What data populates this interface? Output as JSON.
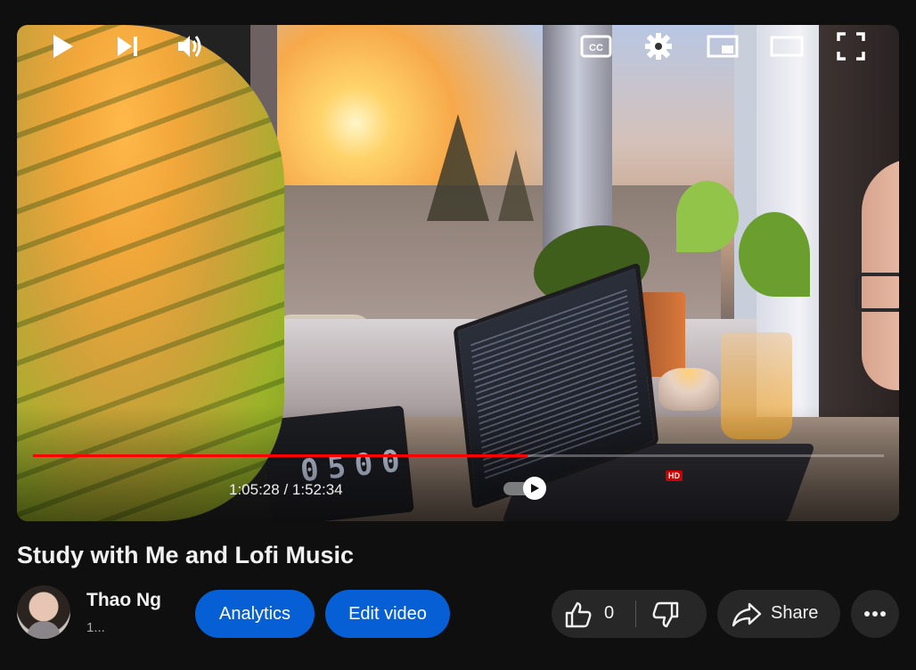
{
  "video": {
    "current_time": "1:05:28",
    "duration": "1:52:34",
    "time_display": "1:05:28 / 1:52:34",
    "progress_fraction": 0.581,
    "progress_color": "#ff0000",
    "clock_digits": "0500",
    "hd_badge": "HD"
  },
  "info": {
    "title": "Study with Me and Lofi Music",
    "channel_name": "Thao Ng",
    "subscriber_text": "1...",
    "analytics_label": "Analytics",
    "edit_label": "Edit video",
    "like_count": "0",
    "share_label": "Share",
    "accent_color": "#065fd4"
  },
  "icons": {
    "play": "play-icon",
    "next": "next-icon",
    "volume": "volume-icon",
    "autoplay": "autoplay-toggle",
    "cc": "cc-icon",
    "settings": "gear-icon",
    "miniplayer": "miniplayer-icon",
    "theater": "theater-icon",
    "fullscreen": "fullscreen-icon",
    "like": "thumbs-up-icon",
    "dislike": "thumbs-down-icon",
    "share": "share-icon",
    "more": "more-icon"
  }
}
